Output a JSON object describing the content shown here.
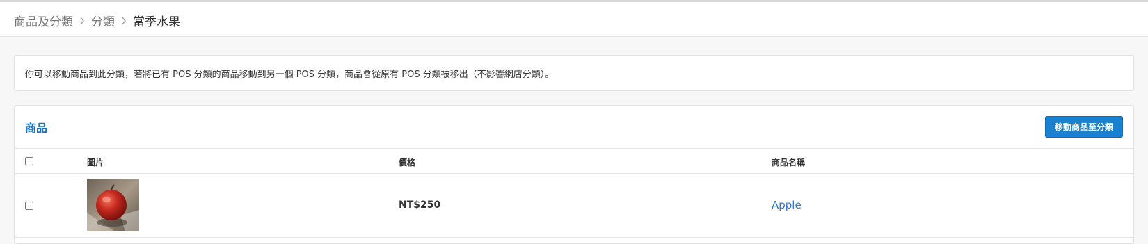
{
  "breadcrumb": {
    "items": [
      "商品及分類",
      "分類"
    ],
    "current": "當季水果"
  },
  "notice": {
    "text": "你可以移動商品到此分類，若將已有 POS 分類的商品移動到另一個 POS 分類，商品會從原有 POS 分類被移出（不影響網店分類）。"
  },
  "panel": {
    "title": "商品",
    "move_button_label": "移動商品至分類"
  },
  "table": {
    "columns": {
      "image": "圖片",
      "price": "價格",
      "name": "商品名稱"
    },
    "rows": [
      {
        "price": "NT$250",
        "name": "Apple",
        "image_icon": "apple-photo",
        "checked": false
      }
    ]
  },
  "colors": {
    "accent": "#1a81d1",
    "link": "#2f77c6",
    "title": "#1a73c4"
  }
}
